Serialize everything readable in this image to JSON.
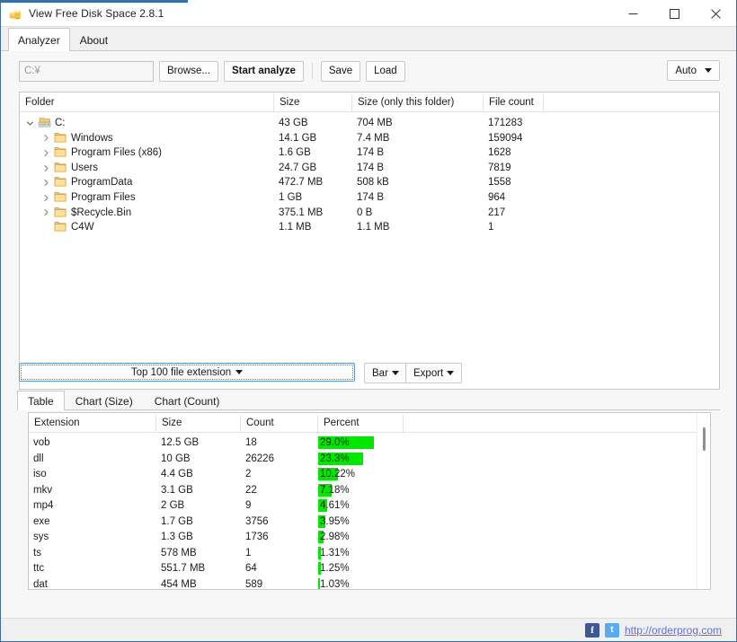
{
  "window": {
    "title": "View Free Disk Space 2.8.1",
    "app_icon": "coins-icon",
    "minimize": "minimize-icon",
    "maximize": "maximize-icon",
    "close": "close-icon"
  },
  "main_tabs": [
    {
      "label": "Analyzer",
      "active": true
    },
    {
      "label": "About",
      "active": false
    }
  ],
  "toolbar": {
    "path_value": "C:¥",
    "path_placeholder": "C:¥",
    "browse_label": "Browse...",
    "start_label": "Start analyze",
    "save_label": "Save",
    "load_label": "Load",
    "auto_label": "Auto"
  },
  "tree": {
    "columns": [
      "Folder",
      "Size",
      "Size (only this folder)",
      "File count"
    ],
    "rows": [
      {
        "name": "C:",
        "indent": 0,
        "icon": "drive-icon",
        "twisty": "chevron-down-icon",
        "size": "43 GB",
        "size_only": "704 MB",
        "count": "171283"
      },
      {
        "name": "Windows",
        "indent": 1,
        "icon": "folder-icon",
        "twisty": "chevron-right-icon",
        "size": "14.1 GB",
        "size_only": "7.4 MB",
        "count": "159094"
      },
      {
        "name": "Program Files (x86)",
        "indent": 1,
        "icon": "folder-icon",
        "twisty": "chevron-right-icon",
        "size": "1.6 GB",
        "size_only": "174 B",
        "count": "1628"
      },
      {
        "name": "Users",
        "indent": 1,
        "icon": "folder-icon",
        "twisty": "chevron-right-icon",
        "size": "24.7 GB",
        "size_only": "174 B",
        "count": "7819"
      },
      {
        "name": "ProgramData",
        "indent": 1,
        "icon": "folder-icon",
        "twisty": "chevron-right-icon",
        "size": "472.7 MB",
        "size_only": "508 kB",
        "count": "1558"
      },
      {
        "name": "Program Files",
        "indent": 1,
        "icon": "folder-icon",
        "twisty": "chevron-right-icon",
        "size": "1 GB",
        "size_only": "174 B",
        "count": "964"
      },
      {
        "name": "$Recycle.Bin",
        "indent": 1,
        "icon": "folder-icon",
        "twisty": "chevron-right-icon",
        "size": "375.1 MB",
        "size_only": "0 B",
        "count": "217"
      },
      {
        "name": "C4W",
        "indent": 1,
        "icon": "folder-icon",
        "twisty": "",
        "size": "1.1 MB",
        "size_only": "1.1 MB",
        "count": "1"
      }
    ]
  },
  "ext_controls": {
    "select_label": "Top 100 file extension",
    "bar_label": "Bar",
    "export_label": "Export"
  },
  "bottom_tabs": [
    {
      "label": "Table",
      "active": true
    },
    {
      "label": "Chart (Size)",
      "active": false
    },
    {
      "label": "Chart (Count)",
      "active": false
    }
  ],
  "ext_table": {
    "columns": [
      "Extension",
      "Size",
      "Count",
      "Percent"
    ],
    "bar_color": "#00e800",
    "rows": [
      {
        "extension": "vob",
        "size": "12.5 GB",
        "count": "18",
        "percent": "29.0%",
        "percent_value": 29.0
      },
      {
        "extension": "dll",
        "size": "10 GB",
        "count": "26226",
        "percent": "23.3%",
        "percent_value": 23.3
      },
      {
        "extension": "iso",
        "size": "4.4 GB",
        "count": "2",
        "percent": "10.22%",
        "percent_value": 10.22
      },
      {
        "extension": "mkv",
        "size": "3.1 GB",
        "count": "22",
        "percent": "7.18%",
        "percent_value": 7.18
      },
      {
        "extension": "mp4",
        "size": "2 GB",
        "count": "9",
        "percent": "4.61%",
        "percent_value": 4.61
      },
      {
        "extension": "exe",
        "size": "1.7 GB",
        "count": "3756",
        "percent": "3.95%",
        "percent_value": 3.95
      },
      {
        "extension": "sys",
        "size": "1.3 GB",
        "count": "1736",
        "percent": "2.98%",
        "percent_value": 2.98
      },
      {
        "extension": "ts",
        "size": "578 MB",
        "count": "1",
        "percent": "1.31%",
        "percent_value": 1.31
      },
      {
        "extension": "ttc",
        "size": "551.7 MB",
        "count": "64",
        "percent": "1.25%",
        "percent_value": 1.25
      },
      {
        "extension": "dat",
        "size": "454 MB",
        "count": "589",
        "percent": "1.03%",
        "percent_value": 1.03
      }
    ]
  },
  "statusbar": {
    "facebook_icon": "facebook-icon",
    "facebook_glyph": "f",
    "twitter_icon": "twitter-icon",
    "twitter_glyph": "t",
    "link": "http://orderprog.com"
  }
}
